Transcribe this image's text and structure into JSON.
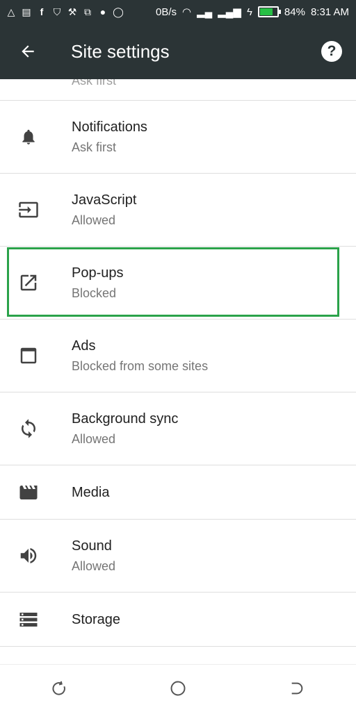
{
  "status_bar": {
    "data_rate": "0B/s",
    "battery_percent": "84%",
    "battery_level": 0.84,
    "time": "8:31 AM",
    "left_icons": [
      "warning-icon",
      "message-icon",
      "facebook-icon",
      "shield-icon",
      "wrench-icon",
      "screenshot-icon",
      "circle-icon",
      "whatsapp-icon"
    ],
    "right_icons": [
      "wifi-icon",
      "signal-icon",
      "signal-icon",
      "charging-icon",
      "battery-icon"
    ]
  },
  "app_bar": {
    "title": "Site settings",
    "back_icon": "back-arrow-icon",
    "help_icon": "help-icon"
  },
  "partial_top_item": {
    "subtitle": "Ask first"
  },
  "settings": [
    {
      "label": "Notifications",
      "subtitle": "Ask first",
      "icon": "bell-icon"
    },
    {
      "label": "JavaScript",
      "subtitle": "Allowed",
      "icon": "javascript-icon"
    },
    {
      "label": "Pop-ups",
      "subtitle": "Blocked",
      "icon": "open-in-new-icon"
    },
    {
      "label": "Ads",
      "subtitle": "Blocked from some sites",
      "icon": "window-icon"
    },
    {
      "label": "Background sync",
      "subtitle": "Allowed",
      "icon": "sync-icon"
    },
    {
      "label": "Media",
      "subtitle": "",
      "icon": "movie-icon"
    },
    {
      "label": "Sound",
      "subtitle": "Allowed",
      "icon": "volume-icon"
    },
    {
      "label": "Storage",
      "subtitle": "",
      "icon": "storage-icon"
    }
  ],
  "nav_bar": {
    "icons": [
      "recents-icon",
      "home-icon",
      "back-nav-icon"
    ]
  },
  "colors": {
    "app_bar": "#2b3436",
    "highlight": "#2aa24a",
    "battery": "#27c045"
  }
}
